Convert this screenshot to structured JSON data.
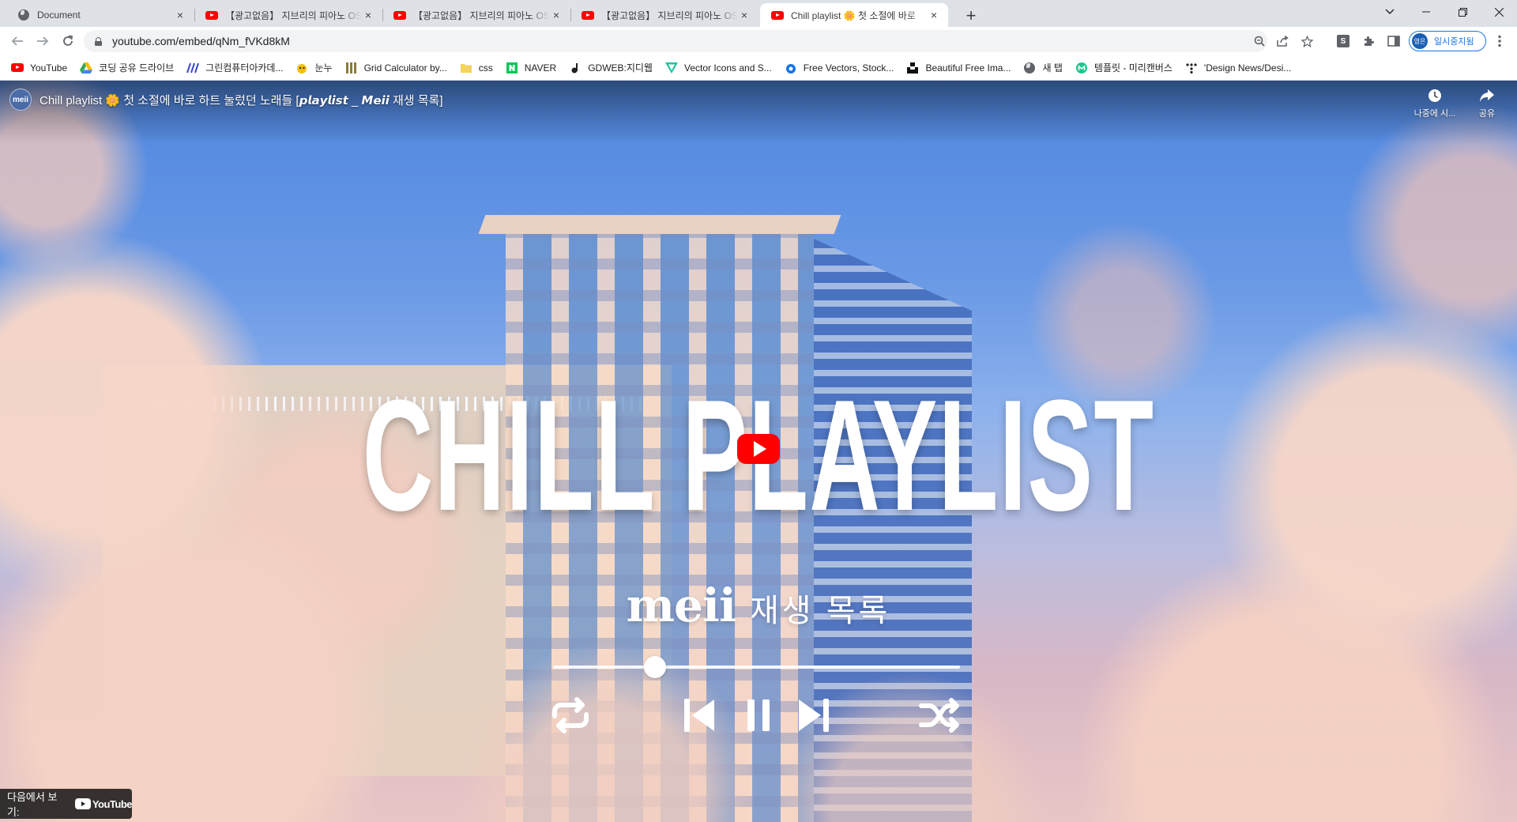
{
  "browser": {
    "tabs": [
      {
        "title": "Document",
        "icon": "globe-icon",
        "active": false
      },
      {
        "title": "【광고없음】 지브리의 피아노 OST",
        "icon": "youtube-icon",
        "active": false
      },
      {
        "title": "【광고없음】 지브리의 피아노 OST",
        "icon": "youtube-icon",
        "active": false
      },
      {
        "title": "【광고없음】 지브리의 피아노 OST",
        "icon": "youtube-icon",
        "active": false
      },
      {
        "title": "Chill playlist 🌼 첫 소절에 바로",
        "icon": "youtube-icon",
        "active": true
      }
    ],
    "close_glyph": "×",
    "new_tab_glyph": "+",
    "address": "youtube.com/embed/qNm_fVKd8kM",
    "profile": {
      "avatar_text": "영은",
      "label": "일시중지됨"
    },
    "bookmarks": [
      {
        "label": "YouTube",
        "icon": "youtube-icon",
        "color": "#ff0000"
      },
      {
        "label": "코딩 공유 드라이브",
        "icon": "google-drive-icon",
        "color": "#34a853"
      },
      {
        "label": "그린컴퓨터아카데...",
        "icon": "slash-logo-icon",
        "color": "#3b47c4"
      },
      {
        "label": "눈누",
        "icon": "noonnu-icon",
        "color": "#f2c200"
      },
      {
        "label": "Grid Calculator by...",
        "icon": "grid-icon",
        "color": "#8a7a3a"
      },
      {
        "label": "css",
        "icon": "folder-icon",
        "color": "#f4d35e"
      },
      {
        "label": "NAVER",
        "icon": "naver-icon",
        "color": "#03c75a"
      },
      {
        "label": "GDWEB:지디웹",
        "icon": "gdweb-icon",
        "color": "#202124"
      },
      {
        "label": "Vector Icons and S...",
        "icon": "vector-icons-icon",
        "color": "#25c19f"
      },
      {
        "label": "Free Vectors, Stock...",
        "icon": "freepik-icon",
        "color": "#1273eb"
      },
      {
        "label": "Beautiful Free Ima...",
        "icon": "unsplash-icon",
        "color": "#111111"
      },
      {
        "label": "새 탭",
        "icon": "globe-icon",
        "color": "#5f6368"
      },
      {
        "label": "템플릿 - 미리캔버스",
        "icon": "miricanvas-icon",
        "color": "#1cc68b"
      },
      {
        "label": "'Design News/Desi...",
        "icon": "dots-logo-icon",
        "color": "#202124"
      }
    ]
  },
  "video": {
    "channel_avatar_text": "meii",
    "title": "Chill playlist 🌼 첫 소절에 바로 하트 눌렀던 노래들 [𝙥𝙡𝙖𝙮𝙡𝙞𝙨𝙩 _ 𝙈𝙚𝙞𝙞 재생 목록]",
    "watch_later_label": "나중에 시...",
    "share_label": "공유",
    "overlay_title": "CHILL PLAYLIST",
    "overlay_brand": "meii",
    "overlay_subtitle": "재생 목록",
    "overlay_progress": 0.25,
    "watch_on_label": "다음에서 보기:",
    "youtube_wordmark": "YouTube"
  }
}
